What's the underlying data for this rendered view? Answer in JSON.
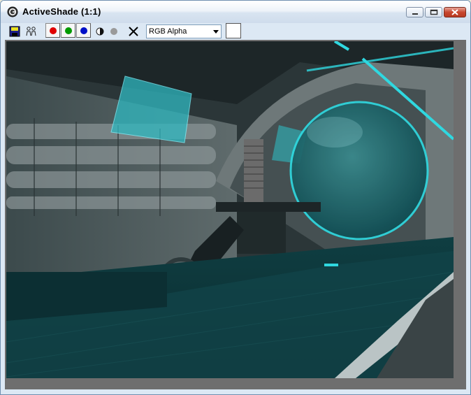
{
  "window": {
    "title": "ActiveShade (1:1)",
    "app_icon": "app-logo-icon",
    "controls": [
      "minimize-icon",
      "maximize-icon",
      "close-icon"
    ]
  },
  "toolbar": {
    "save_icon": "save-icon",
    "clone_icon": "clone-icon",
    "channels": [
      {
        "name": "red-channel",
        "color": "#e00000"
      },
      {
        "name": "green-channel",
        "color": "#009a00"
      },
      {
        "name": "blue-channel",
        "color": "#0010c8"
      }
    ],
    "alpha_icon": "alpha-half-icon",
    "mono_icon": "monochrome-icon",
    "clear_icon": "clear-x-icon",
    "channel_display": "RGB Alpha",
    "swatch_color": "#ffffff"
  },
  "viewport": {
    "accent": "#2fd8e0",
    "content": "rendered-scene-image"
  }
}
